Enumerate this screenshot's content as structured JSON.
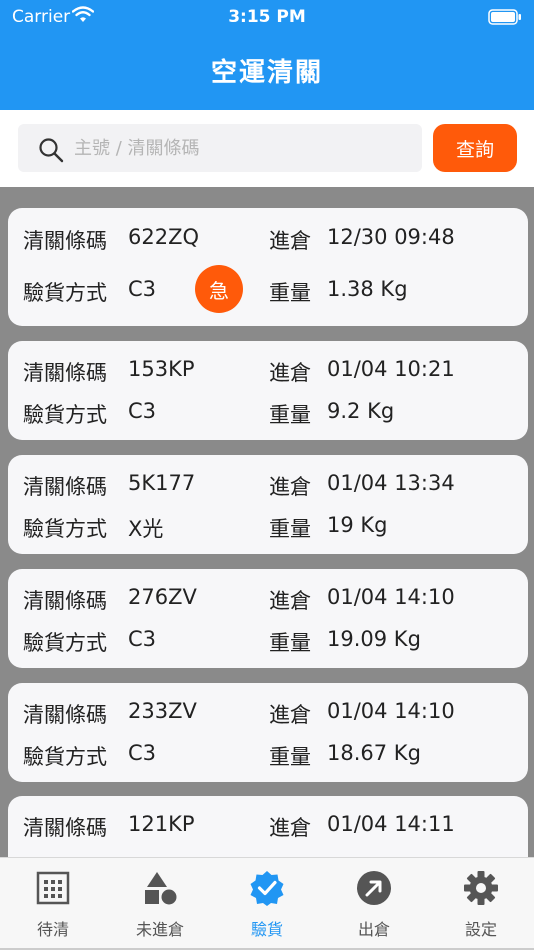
{
  "status_bar": {
    "carrier": "Carrier",
    "time": "3:15 PM"
  },
  "nav": {
    "title": "空運清關"
  },
  "search": {
    "placeholder": "主號 / 清關條碼",
    "button_label": "查詢"
  },
  "labels": {
    "clearance_code": "清關條碼",
    "inspection_method": "驗貨方式",
    "warehouse_in": "進倉",
    "weight": "重量"
  },
  "records": [
    {
      "code": "622ZQ",
      "time": "12/30 09:48",
      "method": "C3",
      "weight": "1.38 Kg",
      "urgent": "急"
    },
    {
      "code": "153KP",
      "time": "01/04 10:21",
      "method": "C3",
      "weight": "9.2 Kg"
    },
    {
      "code": "5K177",
      "time": "01/04 13:34",
      "method": "X光",
      "weight": "19 Kg"
    },
    {
      "code": "276ZV",
      "time": "01/04 14:10",
      "method": "C3",
      "weight": "19.09 Kg"
    },
    {
      "code": "233ZV",
      "time": "01/04 14:10",
      "method": "C3",
      "weight": "18.67 Kg"
    },
    {
      "code": "121KP",
      "time": "01/04 14:11",
      "method": "",
      "weight": ""
    }
  ],
  "tabs": [
    {
      "label": "待清",
      "icon": "grid-icon"
    },
    {
      "label": "未進倉",
      "icon": "shapes-icon"
    },
    {
      "label": "驗貨",
      "icon": "verified-badge-icon"
    },
    {
      "label": "出倉",
      "icon": "arrow-up-right-circle-icon"
    },
    {
      "label": "設定",
      "icon": "gear-icon"
    }
  ],
  "colors": {
    "primary": "#2196f3",
    "accent": "#ff5a0a",
    "active_tab": "#2196f3"
  }
}
